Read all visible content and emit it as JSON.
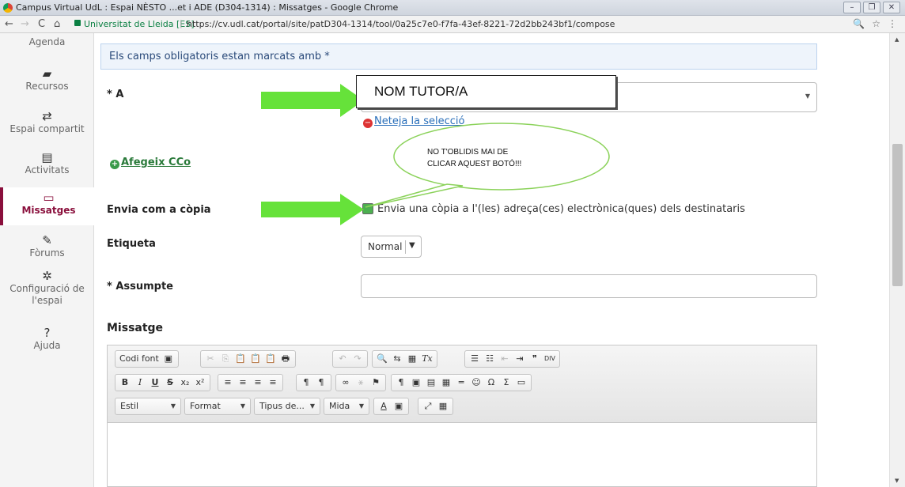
{
  "window": {
    "title": "Campus Virtual UdL : Espai NÈSTO ...et i ADE (D304-1314) : Missatges - Google Chrome",
    "controls": [
      "–",
      "❐",
      "✕"
    ]
  },
  "browser": {
    "nav": [
      "←",
      "→",
      "C",
      "⌂"
    ],
    "site": "Universitat de Lleida [ES]",
    "url": "https://cv.udl.cat/portal/site/patD304-1314/tool/0a25c7e0-f7fa-43ef-8221-72d2bb243bf1/compose",
    "right_icons": [
      "🔍",
      "☆",
      "⋮"
    ]
  },
  "sidebar": {
    "items": [
      {
        "icon": "",
        "label": "Agenda"
      },
      {
        "icon": "▰",
        "label": "Recursos"
      },
      {
        "icon": "⇄",
        "label": "Espai compartit"
      },
      {
        "icon": "▤",
        "label": "Activitats"
      },
      {
        "icon": "▭",
        "label": "Missatges",
        "active": true
      },
      {
        "icon": "✎",
        "label": "Fòrums"
      },
      {
        "icon": "✲",
        "label": "Configuració de l'espai"
      },
      {
        "icon": "?",
        "label": "Ajuda"
      }
    ]
  },
  "form": {
    "notice": "Els camps obligatoris estan marcats amb *",
    "to_label": "* A",
    "clear_selection": "Neteja la selecció",
    "add_cc": "Afegeix CCo",
    "send_copy_label": "Envia com a còpia",
    "send_copy_text": "Envia una còpia a l'(les) adreça(ces) electrònica(ques) dels destinataris",
    "tag_label": "Etiqueta",
    "tag_value": "Normal",
    "subject_label": "* Assumpte",
    "message_label": "Missatge"
  },
  "editor": {
    "row1": {
      "g1": [
        "Codi font",
        "▣"
      ],
      "g2": [
        "✂",
        "⎘",
        "📋",
        "📋",
        "📋",
        "🖶"
      ],
      "g3": [
        "↶",
        "↷"
      ],
      "g4": [
        "🔍",
        "⇆",
        "▦",
        "Tx"
      ],
      "g5": [
        "☰",
        "☷",
        "⇤",
        "⇥",
        "❞",
        "DIV"
      ]
    },
    "row2": {
      "g1": [
        "B",
        "I",
        "U",
        "S",
        "x₂",
        "x²"
      ],
      "g2": [
        "≡",
        "≡",
        "≡",
        "≡"
      ],
      "g3": [
        "¶",
        "¶"
      ],
      "g4": [
        "∞",
        "⚹",
        "⚑"
      ],
      "g5": [
        "¶",
        "▣",
        "▤",
        "▦",
        "═",
        "☺",
        "Ω",
        "Σ",
        "▭"
      ]
    },
    "row3": {
      "combos": [
        "Estil",
        "Format",
        "Tipus de...",
        "Mida"
      ],
      "colors": [
        "A",
        "▣"
      ],
      "misc": [
        "⤢",
        "▦"
      ]
    }
  },
  "annotations": {
    "tutor_box": "NOM TUTOR/A",
    "bubble_line1": "NO T'OBLIDIS MAI DE",
    "bubble_line2": "CLICAR AQUEST BOTÓ!!!",
    "arrow_color": "#66e23a",
    "bubble_border": "#8bd25a"
  },
  "colors": {
    "accent": "#8a0f3c",
    "link": "#2a6fba",
    "notice_bg": "#eef4fb"
  }
}
